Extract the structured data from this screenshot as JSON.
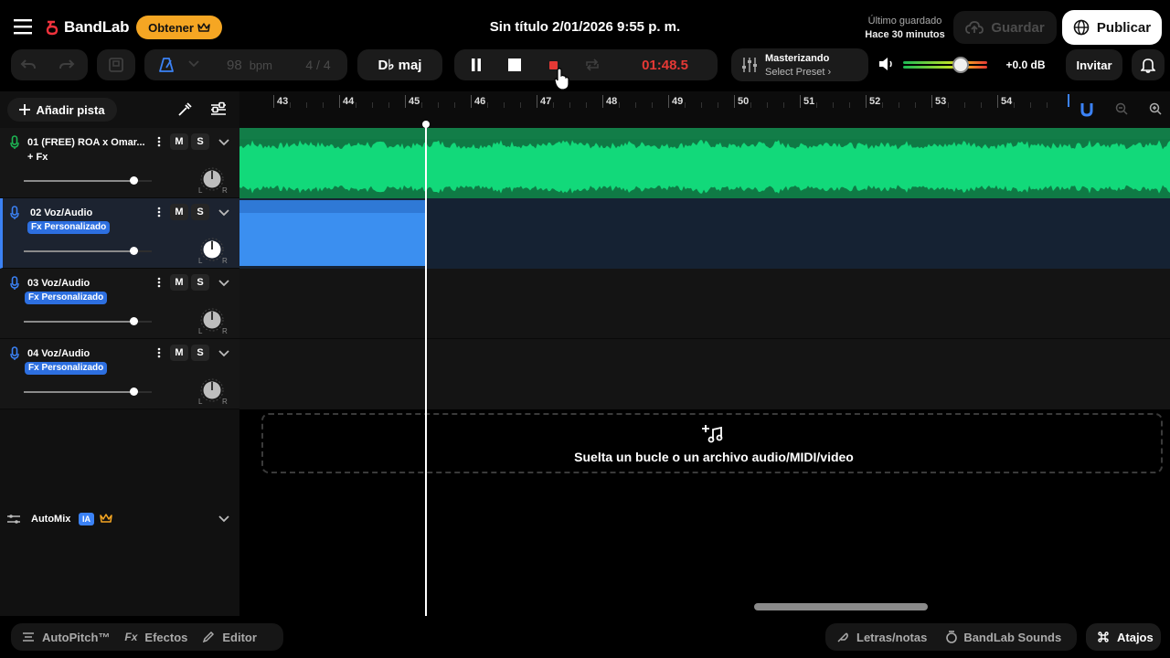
{
  "header": {
    "app_name": "BandLab",
    "get_label": "Obtener",
    "project_title": "Sin título 2/01/2026 9:55 p. m.",
    "last_saved_label": "Último guardado",
    "last_saved_value": "Hace 30 minutos",
    "save_label": "Guardar",
    "publish_label": "Publicar"
  },
  "toolbar": {
    "bpm_value": "98",
    "bpm_unit": "bpm",
    "time_signature": "4 / 4",
    "key": "D♭ maj",
    "time_display": "01:48.5",
    "mastering_title": "Masterizando",
    "mastering_preset": "Select Preset",
    "volume_db": "+0.0 dB",
    "master_volume_fraction": 0.68,
    "invite_label": "Invitar"
  },
  "left_panel": {
    "add_track_label": "Añadir pista",
    "tracks": [
      {
        "name": "01  (FREE) ROA x Omar...",
        "fx": "+ Fx",
        "fx_style": "plain",
        "mic_color": "#1db954",
        "volume_fraction": 0.86
      },
      {
        "name": "02  Voz/Audio",
        "fx": "Fx Personalizado",
        "fx_style": "tag",
        "mic_color": "#3b82f6",
        "volume_fraction": 0.86
      },
      {
        "name": "03  Voz/Audio",
        "fx": "Fx Personalizado",
        "fx_style": "tag",
        "mic_color": "#3b82f6",
        "volume_fraction": 0.86
      },
      {
        "name": "04  Voz/Audio",
        "fx": "Fx Personalizado",
        "fx_style": "tag",
        "mic_color": "#3b82f6",
        "volume_fraction": 0.86
      }
    ],
    "mute_label": "M",
    "solo_label": "S",
    "pan_left": "L",
    "pan_right": "R",
    "automix_label": "AutoMix",
    "automix_badge": "IA"
  },
  "timeline": {
    "bars": [
      "43",
      "44",
      "45",
      "46",
      "47",
      "48",
      "49",
      "50",
      "51",
      "52",
      "53",
      "54"
    ],
    "drop_text": "Suelta un bucle o un archivo audio/MIDI/video"
  },
  "bottom_bar": {
    "autopitch_label": "AutoPitch™",
    "effects_label": "Efectos",
    "editor_label": "Editor",
    "lyrics_label": "Letras/notas",
    "sounds_label": "BandLab Sounds",
    "shortcuts_label": "Atajos"
  },
  "colors": {
    "accent": "#f5a623",
    "waveform": "#12d97a",
    "waveform_bg": "#0f7a45",
    "vocal_region": "#3b8ff0",
    "record": "#e53935",
    "time": "#e53935",
    "fx_tag": "#2d6fe0"
  },
  "icons": [
    "menu-icon",
    "bandlab-logo-icon",
    "crown-icon",
    "cloud-upload-icon",
    "globe-icon",
    "undo-icon",
    "redo-icon",
    "save-template-icon",
    "metronome-icon",
    "chevron-down-icon",
    "pause-icon",
    "stop-icon",
    "record-icon",
    "loop-icon",
    "mixer-icon",
    "speaker-icon",
    "bell-icon",
    "plus-icon",
    "tuner-icon",
    "mix-settings-icon",
    "mic-icon",
    "more-icon",
    "knob-icon",
    "magnet-icon",
    "zoom-out-icon",
    "zoom-in-icon",
    "music-plus-icon",
    "waveform-icon",
    "fx-icon",
    "pencil-icon",
    "feather-icon",
    "bandlab-sounds-icon",
    "command-icon"
  ]
}
